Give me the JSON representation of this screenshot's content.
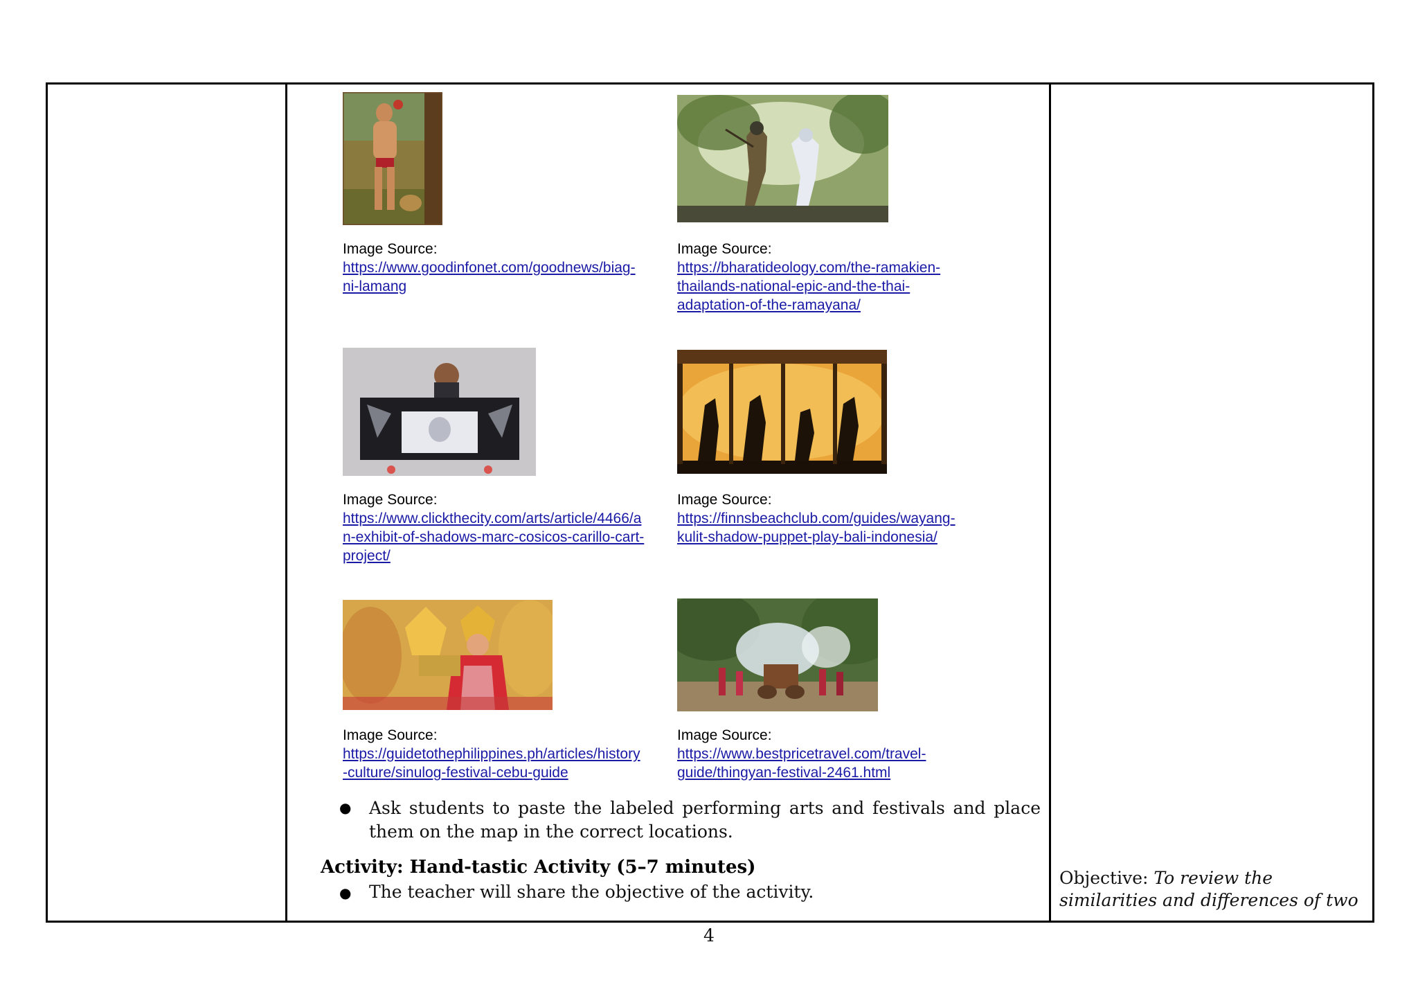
{
  "images": [
    {
      "name": "biag-ni-lamang-image",
      "caption_label": "Image Source:",
      "url_lines": [
        "https://www.goodinfonet.com/goodnews/biag-",
        "ni-lamang"
      ]
    },
    {
      "name": "ramakien-image",
      "caption_label": "Image Source:",
      "url_lines": [
        "https://bharatideology.com/the-ramakien-",
        "thailands-national-epic-and-the-thai-",
        "adaptation-of-the-ramayana/"
      ]
    },
    {
      "name": "shadow-puppet-exhibit-image",
      "caption_label": "Image Source:",
      "url_lines": [
        "https://www.clickthecity.com/arts/article/4466/a",
        "n-exhibit-of-shadows-marc-cosicos-carillo-cart-",
        "project/"
      ]
    },
    {
      "name": "wayang-kulit-image",
      "caption_label": "Image Source:",
      "url_lines": [
        "https://finnsbeachclub.com/guides/wayang-",
        "kulit-shadow-puppet-play-bali-indonesia/"
      ]
    },
    {
      "name": "sinulog-festival-image",
      "caption_label": "Image Source:",
      "url_lines": [
        "https://guidetothephilippines.ph/articles/history",
        "-culture/sinulog-festival-cebu-guide"
      ]
    },
    {
      "name": "thingyan-festival-image",
      "caption_label": "Image Source:",
      "url_lines": [
        "https://www.bestpricetravel.com/travel-",
        "guide/thingyan-festival-2461.html"
      ]
    }
  ],
  "bullet1": {
    "line1": "Ask students to paste the labeled performing arts and festivals and place",
    "line2": "them on the map in the correct locations."
  },
  "activity_heading": "Activity: Hand-tastic Activity (5–7 minutes)",
  "bullet2": "The teacher will share the objective of the activity.",
  "objective": {
    "label": "Objective:",
    "text_line1": "To review the",
    "text_line2": "similarities and differences of two"
  },
  "page_number": "4",
  "colors": {
    "link": "#1a1aa6",
    "border": "#000000"
  }
}
